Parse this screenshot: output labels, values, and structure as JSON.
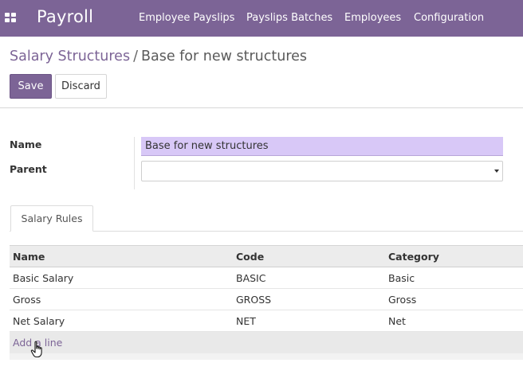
{
  "navbar": {
    "brand": "Payroll",
    "items": [
      {
        "label": "Employee Payslips"
      },
      {
        "label": "Payslips Batches"
      },
      {
        "label": "Employees"
      },
      {
        "label": "Configuration"
      }
    ],
    "icon": "apps-grid-icon"
  },
  "breadcrumb": {
    "parent": "Salary Structures",
    "separator": "/",
    "current": "Base for new structures"
  },
  "buttons": {
    "save": "Save",
    "discard": "Discard"
  },
  "form": {
    "name_label": "Name",
    "name_value": "Base for new structures",
    "parent_label": "Parent",
    "parent_value": ""
  },
  "tabs": [
    {
      "label": "Salary Rules",
      "active": true
    }
  ],
  "table": {
    "headers": [
      "Name",
      "Code",
      "Category"
    ],
    "rows": [
      {
        "name": "Basic Salary",
        "code": "BASIC",
        "category": "Basic"
      },
      {
        "name": "Gross",
        "code": "GROSS",
        "category": "Gross"
      },
      {
        "name": "Net Salary",
        "code": "NET",
        "category": "Net"
      }
    ],
    "add_line": "Add a line"
  },
  "colors": {
    "brand": "#7c6496",
    "highlight_input": "#d8c8f7"
  }
}
